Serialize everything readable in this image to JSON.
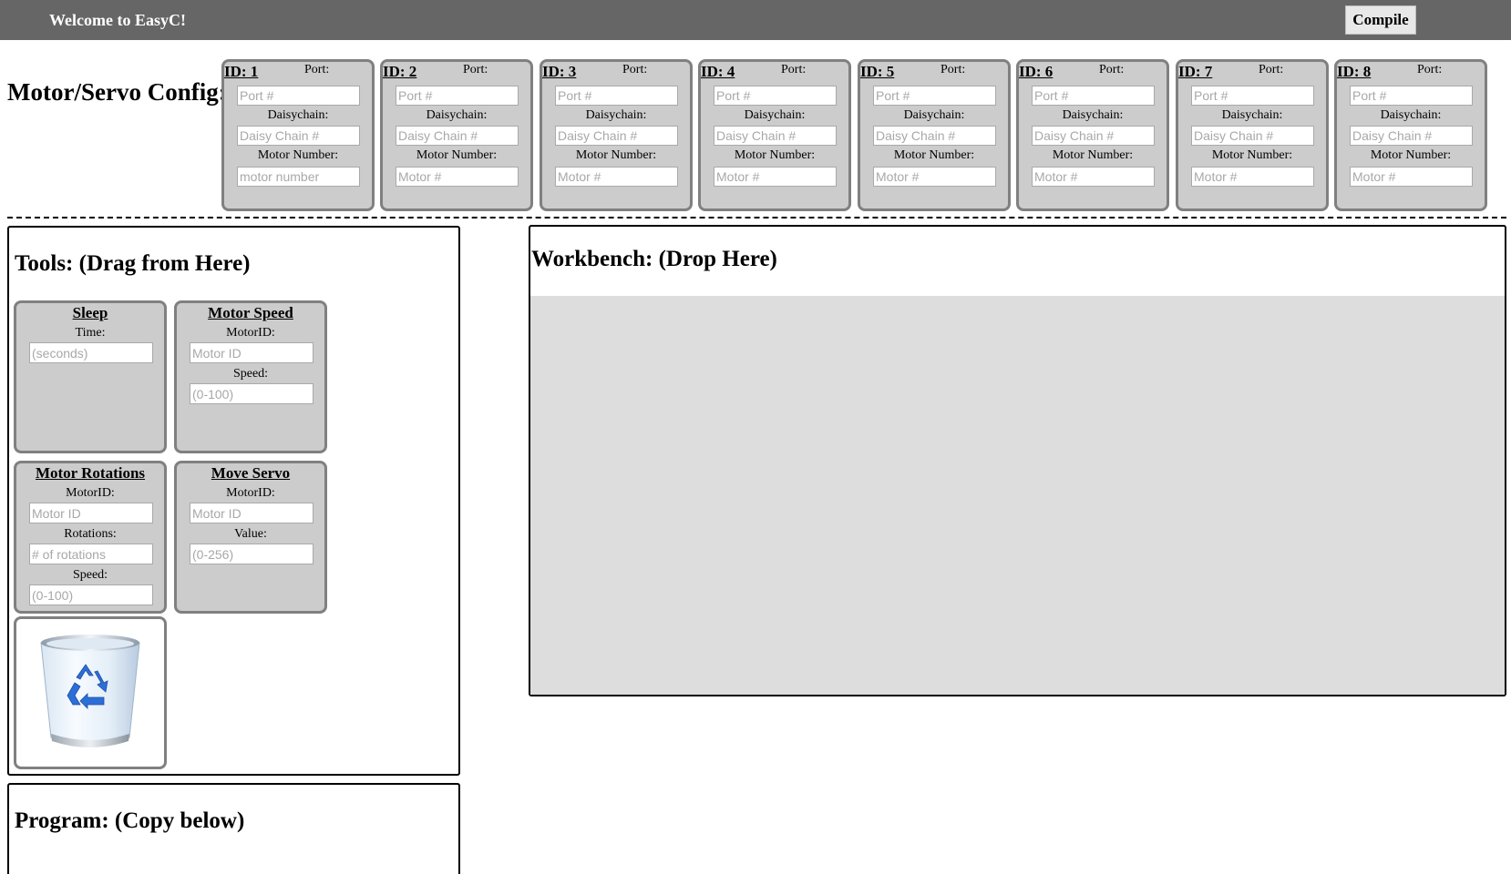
{
  "header": {
    "welcome": "Welcome to EasyC!",
    "compile_label": "Compile"
  },
  "config": {
    "title": "Motor/Servo Config:",
    "port_label": "Port:",
    "daisychain_label": "Daisychain:",
    "motor_number_label": "Motor Number:",
    "port_placeholder": "Port #",
    "daisychain_placeholder": "Daisy Chain #",
    "cards": [
      {
        "id": "ID: 1",
        "motor_placeholder": "motor number"
      },
      {
        "id": "ID: 2",
        "motor_placeholder": "Motor #"
      },
      {
        "id": "ID: 3",
        "motor_placeholder": "Motor #"
      },
      {
        "id": "ID: 4",
        "motor_placeholder": "Motor #"
      },
      {
        "id": "ID: 5",
        "motor_placeholder": "Motor #"
      },
      {
        "id": "ID: 6",
        "motor_placeholder": "Motor #"
      },
      {
        "id": "ID: 7",
        "motor_placeholder": "Motor #"
      },
      {
        "id": "ID: 8",
        "motor_placeholder": "Motor #"
      }
    ]
  },
  "tools": {
    "title": "Tools: (Drag from Here)",
    "sleep": {
      "title": "Sleep",
      "time_label": "Time:",
      "time_placeholder": "(seconds)"
    },
    "motor_speed": {
      "title": "Motor Speed",
      "motorid_label": "MotorID:",
      "motorid_placeholder": "Motor ID",
      "speed_label": "Speed:",
      "speed_placeholder": "(0-100)"
    },
    "motor_rotations": {
      "title": "Motor Rotations",
      "motorid_label": "MotorID:",
      "motorid_placeholder": "Motor ID",
      "rotations_label": "Rotations:",
      "rotations_placeholder": "# of rotations",
      "speed_label": "Speed:",
      "speed_placeholder": "(0-100)"
    },
    "move_servo": {
      "title": "Move Servo",
      "motorid_label": "MotorID:",
      "motorid_placeholder": "Motor ID",
      "value_label": "Value:",
      "value_placeholder": "(0-256)"
    },
    "trash_icon": "recycle-bin-icon"
  },
  "workbench": {
    "title": "Workbench: (Drop Here)"
  },
  "program": {
    "title": "Program: (Copy below)"
  },
  "colors": {
    "header_bg": "#666666",
    "card_bg": "#cccccc",
    "card_border": "#808080",
    "workbench_bg": "#dddddd",
    "recycle_blue": "#2d6fd6"
  }
}
